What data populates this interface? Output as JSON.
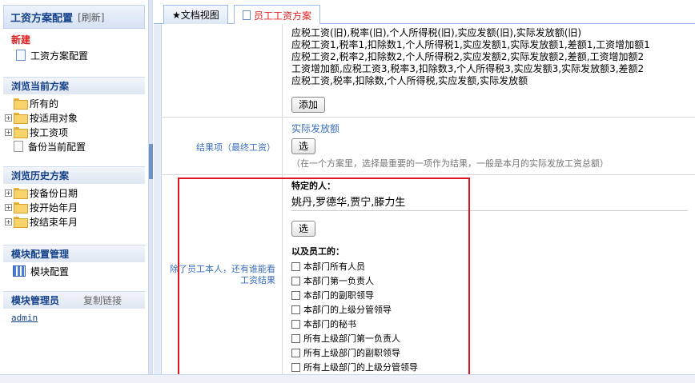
{
  "sidebar": {
    "title": "工资方案配置",
    "refresh": "[刷新]",
    "new_label": "新建",
    "new_items": [
      "工资方案配置"
    ],
    "browse_current": "浏览当前方案",
    "current_items": [
      {
        "label": "所有的",
        "expandable": false
      },
      {
        "label": "按适用对象",
        "expandable": true
      },
      {
        "label": "按工资项",
        "expandable": true
      },
      {
        "label": "备份当前配置",
        "expandable": false
      }
    ],
    "browse_history": "浏览历史方案",
    "history_items": [
      {
        "label": "按备份日期"
      },
      {
        "label": "按开始年月"
      },
      {
        "label": "按结束年月"
      }
    ],
    "module_config": "模块配置管理",
    "module_items": [
      "模块配置"
    ],
    "module_admin": "模块管理员",
    "copy_link": "复制链接",
    "admin_user": "admin"
  },
  "tabs": [
    {
      "label": "★文档视图"
    },
    {
      "label": "员工工资方案"
    }
  ],
  "formula_lines": [
    "应税工资(旧),税率(旧),个人所得税(旧),实应发额(旧),实际发放额(旧)",
    "应税工资1,税率1,扣除数1,个人所得税1,实应发额1,实际发放额1,差额1,工资增加额1",
    "应税工资2,税率2,扣除数2,个人所得税2,实应发额2,实际发放额2,差额,工资增加额2",
    "工资增加额,应税工资3,税率3,扣除数3,个人所得税3,实应发额3,实际发放额3,差额2",
    "应税工资,税率,扣除数,个人所得税,实应发额,实际发放额"
  ],
  "add_button": "添加",
  "result": {
    "label": "结果项（最终工资）",
    "value": "实际发放额",
    "select_button": "选",
    "hint": "（在一个方案里，选择最重要的一项作为结果，一般是本月的实际发放工资总额）"
  },
  "viewers": {
    "label_line1": "除了员工本人，还有谁能看",
    "label_line2": "工资结果",
    "specific_label": "特定的人：",
    "specific_value": "姚丹,罗德华,贾宁,滕力生",
    "select_button": "选",
    "staff_label": "以及员工的：",
    "options": [
      "本部门所有人员",
      "本部门第一负责人",
      "本部门的副职领导",
      "本部门的上级分管领导",
      "本部门的秘书",
      "所有上级部门第一负责人",
      "所有上级部门的副职领导",
      "所有上级部门的上级分管领导"
    ]
  },
  "colors": {
    "accent_red": "#e02020",
    "header_blue": "#15428b",
    "link_blue": "#3a6fbf",
    "highlight_box": "#e0141e"
  }
}
